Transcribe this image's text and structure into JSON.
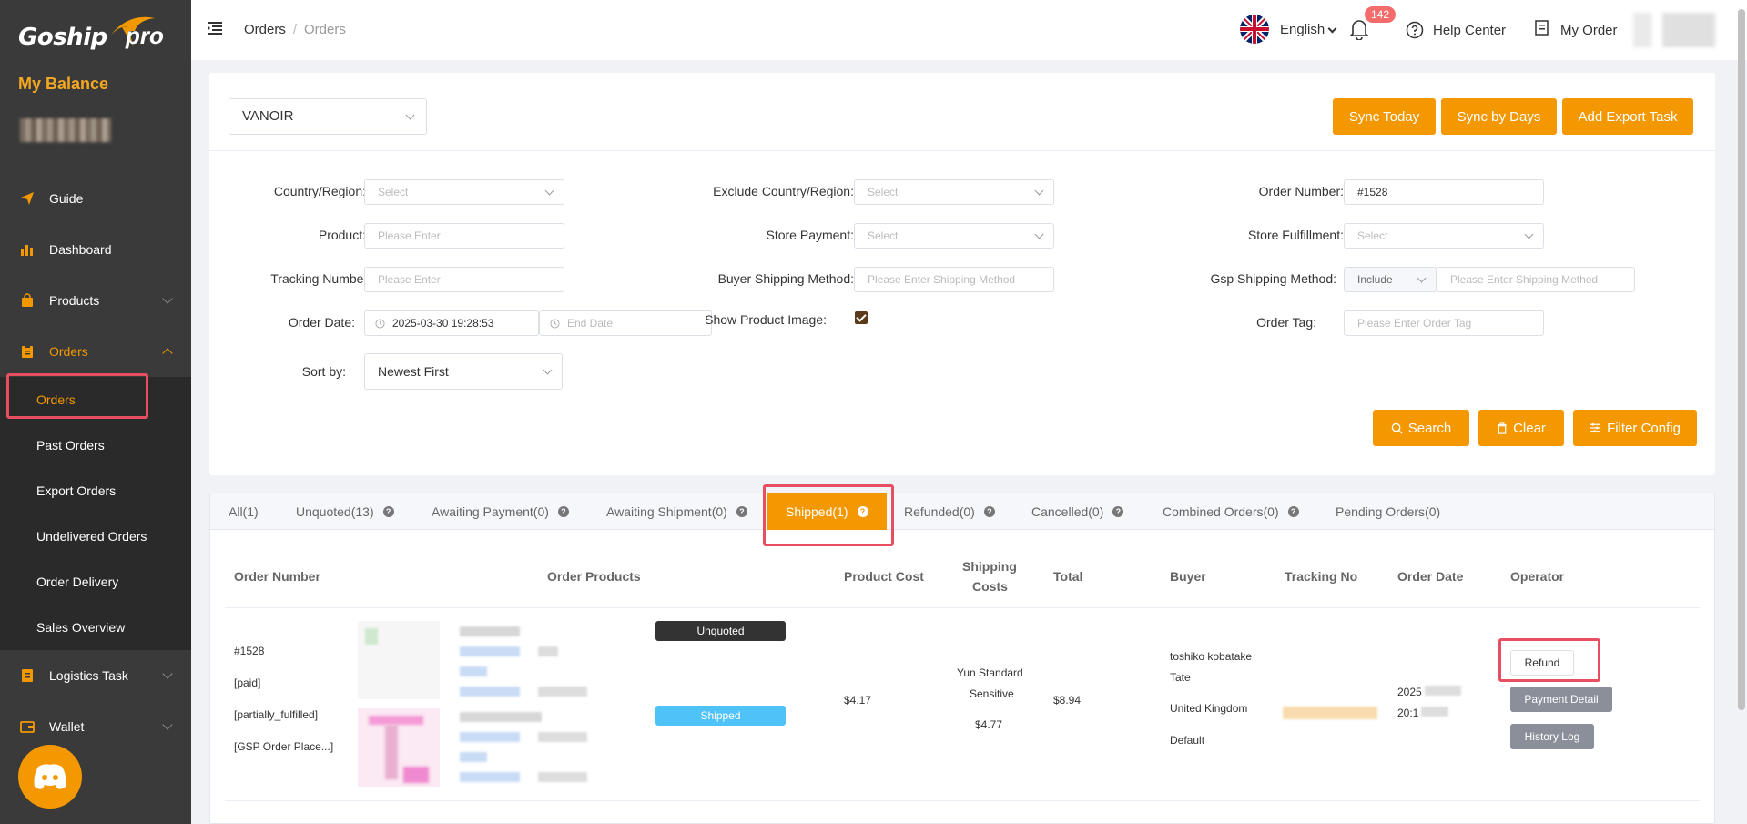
{
  "brand": {
    "logo_text": "Goship",
    "logo_pro": "pro",
    "balance_label": "My Balance"
  },
  "sidebar": {
    "items": [
      {
        "label": "Guide"
      },
      {
        "label": "Dashboard"
      },
      {
        "label": "Products"
      },
      {
        "label": "Orders"
      },
      {
        "label": "Logistics Task"
      },
      {
        "label": "Wallet"
      }
    ],
    "orders_sub": [
      {
        "label": "Orders"
      },
      {
        "label": "Past Orders"
      },
      {
        "label": "Export Orders"
      },
      {
        "label": "Undelivered Orders"
      },
      {
        "label": "Order Delivery"
      },
      {
        "label": "Sales Overview"
      }
    ]
  },
  "header": {
    "breadcrumb": [
      "Orders",
      "Orders"
    ],
    "language": "English",
    "notification_count": "142",
    "help_center": "Help Center",
    "my_order": "My Order"
  },
  "filters": {
    "store": "VANOIR",
    "sync_today": "Sync Today",
    "sync_by_days": "Sync by Days",
    "add_export_task": "Add Export Task",
    "country_label": "Country/Region:",
    "country_placeholder": "Select",
    "exclude_country_label": "Exclude Country/Region:",
    "exclude_country_placeholder": "Select",
    "order_number_label": "Order Number:",
    "order_number_value": "#1528",
    "product_label": "Product:",
    "product_placeholder": "Please Enter",
    "store_payment_label": "Store Payment:",
    "store_payment_placeholder": "Select",
    "store_fulfillment_label": "Store Fulfillment:",
    "store_fulfillment_placeholder": "Select",
    "tracking_label": "Tracking Number:",
    "tracking_placeholder": "Please Enter",
    "buyer_shipping_label": "Buyer Shipping Method:",
    "buyer_shipping_placeholder": "Please Enter Shipping Method",
    "gsp_shipping_label": "Gsp Shipping Method:",
    "gsp_include": "Include",
    "gsp_shipping_placeholder": "Please Enter Shipping Method",
    "order_date_label": "Order Date:",
    "order_date_start": "2025-03-30 19:28:53",
    "order_date_end_placeholder": "End Date",
    "show_image_label": "Show Product Image:",
    "order_tag_label": "Order Tag:",
    "order_tag_placeholder": "Please Enter Order Tag",
    "sort_label": "Sort by:",
    "sort_value": "Newest First",
    "search": "Search",
    "clear": "Clear",
    "filter_config": "Filter Config"
  },
  "tabs": [
    {
      "label": "All(1)",
      "help": false
    },
    {
      "label": "Unquoted(13)",
      "help": true
    },
    {
      "label": "Awaiting Payment(0)",
      "help": true
    },
    {
      "label": "Awaiting Shipment(0)",
      "help": true
    },
    {
      "label": "Shipped(1)",
      "help": true,
      "active": true
    },
    {
      "label": "Refunded(0)",
      "help": true
    },
    {
      "label": "Cancelled(0)",
      "help": true
    },
    {
      "label": "Combined Orders(0)",
      "help": true
    },
    {
      "label": "Pending Orders(0)",
      "help": false
    }
  ],
  "table": {
    "headers": {
      "order_number": "Order Number",
      "order_products": "Order Products",
      "product_cost": "Product Cost",
      "shipping_costs_1": "Shipping",
      "shipping_costs_2": "Costs",
      "total": "Total",
      "buyer": "Buyer",
      "tracking_no": "Tracking No",
      "order_date": "Order Date",
      "operator": "Operator"
    },
    "row": {
      "order_number": "#1528",
      "status_paid": "[paid]",
      "status_fulfilled": "[partially_fulfilled]",
      "status_gsp": "[GSP Order Place...]",
      "tag_unquoted": "Unquoted",
      "tag_shipped": "Shipped",
      "product_cost": "$4.17",
      "shipping_method_1": "Yun Standard",
      "shipping_method_2": "Sensitive",
      "shipping_cost": "$4.77",
      "total": "$8.94",
      "buyer_name_1": "toshiko kobatake",
      "buyer_name_2": "Tate",
      "buyer_country": "United Kingdom",
      "buyer_default": "Default",
      "order_date_1": "2025",
      "order_date_2": "20:1",
      "refund": "Refund",
      "payment_detail": "Payment Detail",
      "history_log": "History Log"
    }
  },
  "colors": {
    "accent": "#f39800",
    "highlight": "#e84e62",
    "sidebar_bg": "#3a3a3a"
  }
}
